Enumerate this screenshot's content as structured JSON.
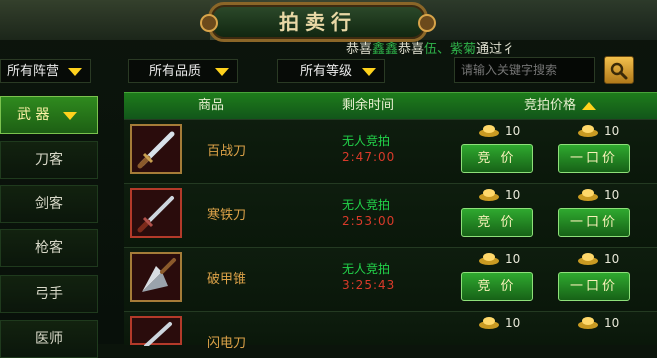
{
  "title": "拍卖行",
  "marquee": {
    "part1": "恭喜",
    "part2": "鑫鑫",
    "part3": "恭喜",
    "part4": "伍、紫菊",
    "part5": "通过彳"
  },
  "filters": [
    {
      "label": "所有阵营"
    },
    {
      "label": "所有品质"
    },
    {
      "label": "所有等级"
    }
  ],
  "search": {
    "placeholder": "请输入关键字搜索"
  },
  "sidebar": {
    "items": [
      {
        "label": "武 器"
      },
      {
        "label": "刀客"
      },
      {
        "label": "剑客"
      },
      {
        "label": "枪客"
      },
      {
        "label": "弓手"
      },
      {
        "label": "医师"
      }
    ]
  },
  "table": {
    "headers": {
      "item": "商品",
      "time": "剩余时间",
      "price": "竞拍价格"
    },
    "rows": [
      {
        "name": "百战刀",
        "status": "无人竞拍",
        "time": "2:47:00",
        "bid_price": "10",
        "buyout_price": "10",
        "bid_label": "竞 价",
        "buyout_label": "一口价"
      },
      {
        "name": "寒铁刀",
        "status": "无人竞拍",
        "time": "2:53:00",
        "bid_price": "10",
        "buyout_price": "10",
        "bid_label": "竞 价",
        "buyout_label": "一口价"
      },
      {
        "name": "破甲锥",
        "status": "无人竞拍",
        "time": "3:25:43",
        "bid_price": "10",
        "buyout_price": "10",
        "bid_label": "竞 价",
        "buyout_label": "一口价"
      },
      {
        "name": "闪电刀",
        "status": "",
        "time": "",
        "bid_price": "10",
        "buyout_price": "10",
        "bid_label": "",
        "buyout_label": ""
      }
    ]
  },
  "colors": {
    "accent_green": "#1e7c1b",
    "gold_text": "#dba148",
    "status_green": "#22d44a",
    "timer_red": "#d93a2a"
  }
}
